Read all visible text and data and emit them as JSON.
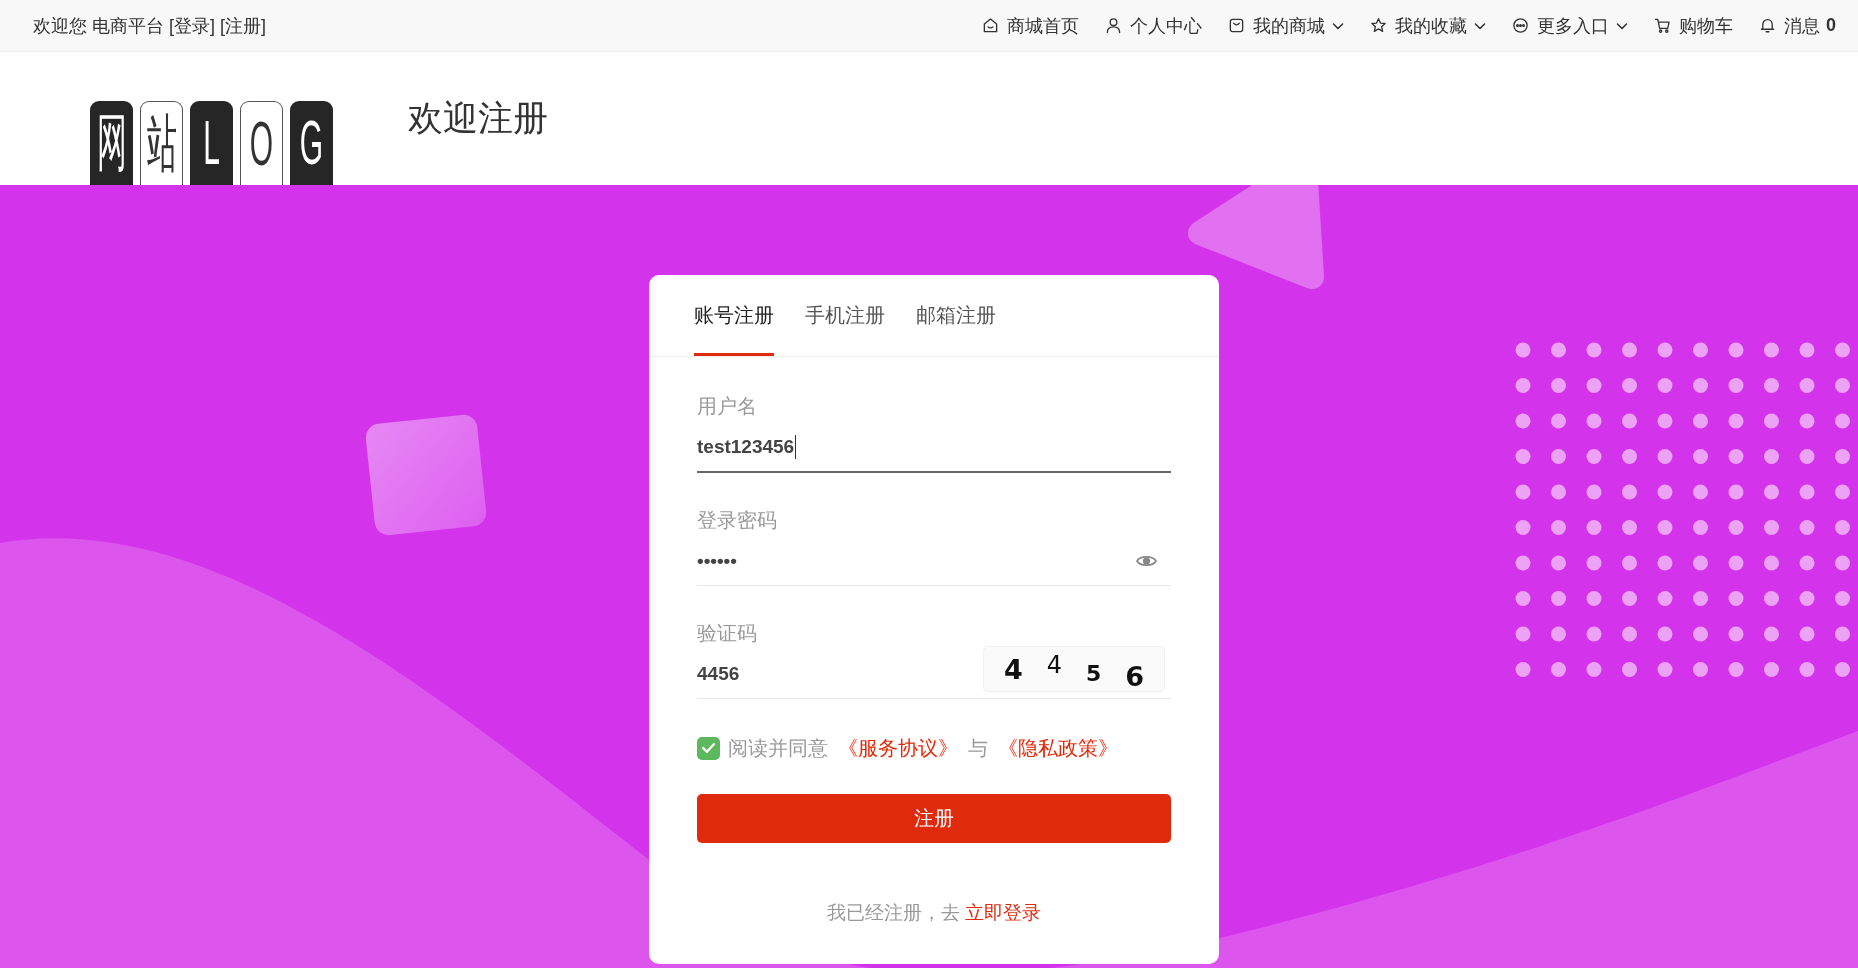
{
  "top_bar": {
    "welcome": "欢迎您 电商平台",
    "links": [
      "[登录]",
      "[注册]"
    ],
    "nav": [
      {
        "label": "商城首页",
        "dropdown": false
      },
      {
        "label": "个人中心",
        "dropdown": false
      },
      {
        "label": "我的商城",
        "dropdown": true
      },
      {
        "label": "我的收藏",
        "dropdown": true
      },
      {
        "label": "更多入口",
        "dropdown": true
      },
      {
        "label": "购物车",
        "dropdown": false
      },
      {
        "label": "消息",
        "dropdown": false,
        "count": "0"
      }
    ]
  },
  "header": {
    "logo": [
      {
        "char": "网",
        "dark": true
      },
      {
        "char": "站",
        "dark": false
      },
      {
        "char": "L",
        "dark": true
      },
      {
        "char": "O",
        "dark": false
      },
      {
        "char": "G",
        "dark": true
      }
    ],
    "title": "欢迎注册"
  },
  "card": {
    "tabs": [
      {
        "label": "账号注册",
        "selected": true
      },
      {
        "label": "手机注册",
        "selected": false
      },
      {
        "label": "邮箱注册",
        "selected": false
      }
    ],
    "fields": [
      {
        "kind": "text",
        "label": "用户名",
        "value": "test123456",
        "focused": true
      },
      {
        "kind": "password",
        "label": "登录密码",
        "value": "••••••",
        "focused": false
      },
      {
        "kind": "captcha",
        "label": "验证码",
        "value": "4456",
        "focused": false,
        "captcha_digits": [
          "4",
          "4",
          "5",
          "6"
        ]
      }
    ],
    "agreement": {
      "checked": true,
      "parts": [
        {
          "kind": "text",
          "text": "阅读并同意"
        },
        {
          "kind": "link",
          "text": "《服务协议》"
        },
        {
          "kind": "text",
          "text": "与"
        },
        {
          "kind": "link",
          "text": "《隐私政策》"
        }
      ]
    },
    "submit": "注册",
    "footer": {
      "text": "我已经注册，去",
      "link": "立即登录"
    }
  }
}
